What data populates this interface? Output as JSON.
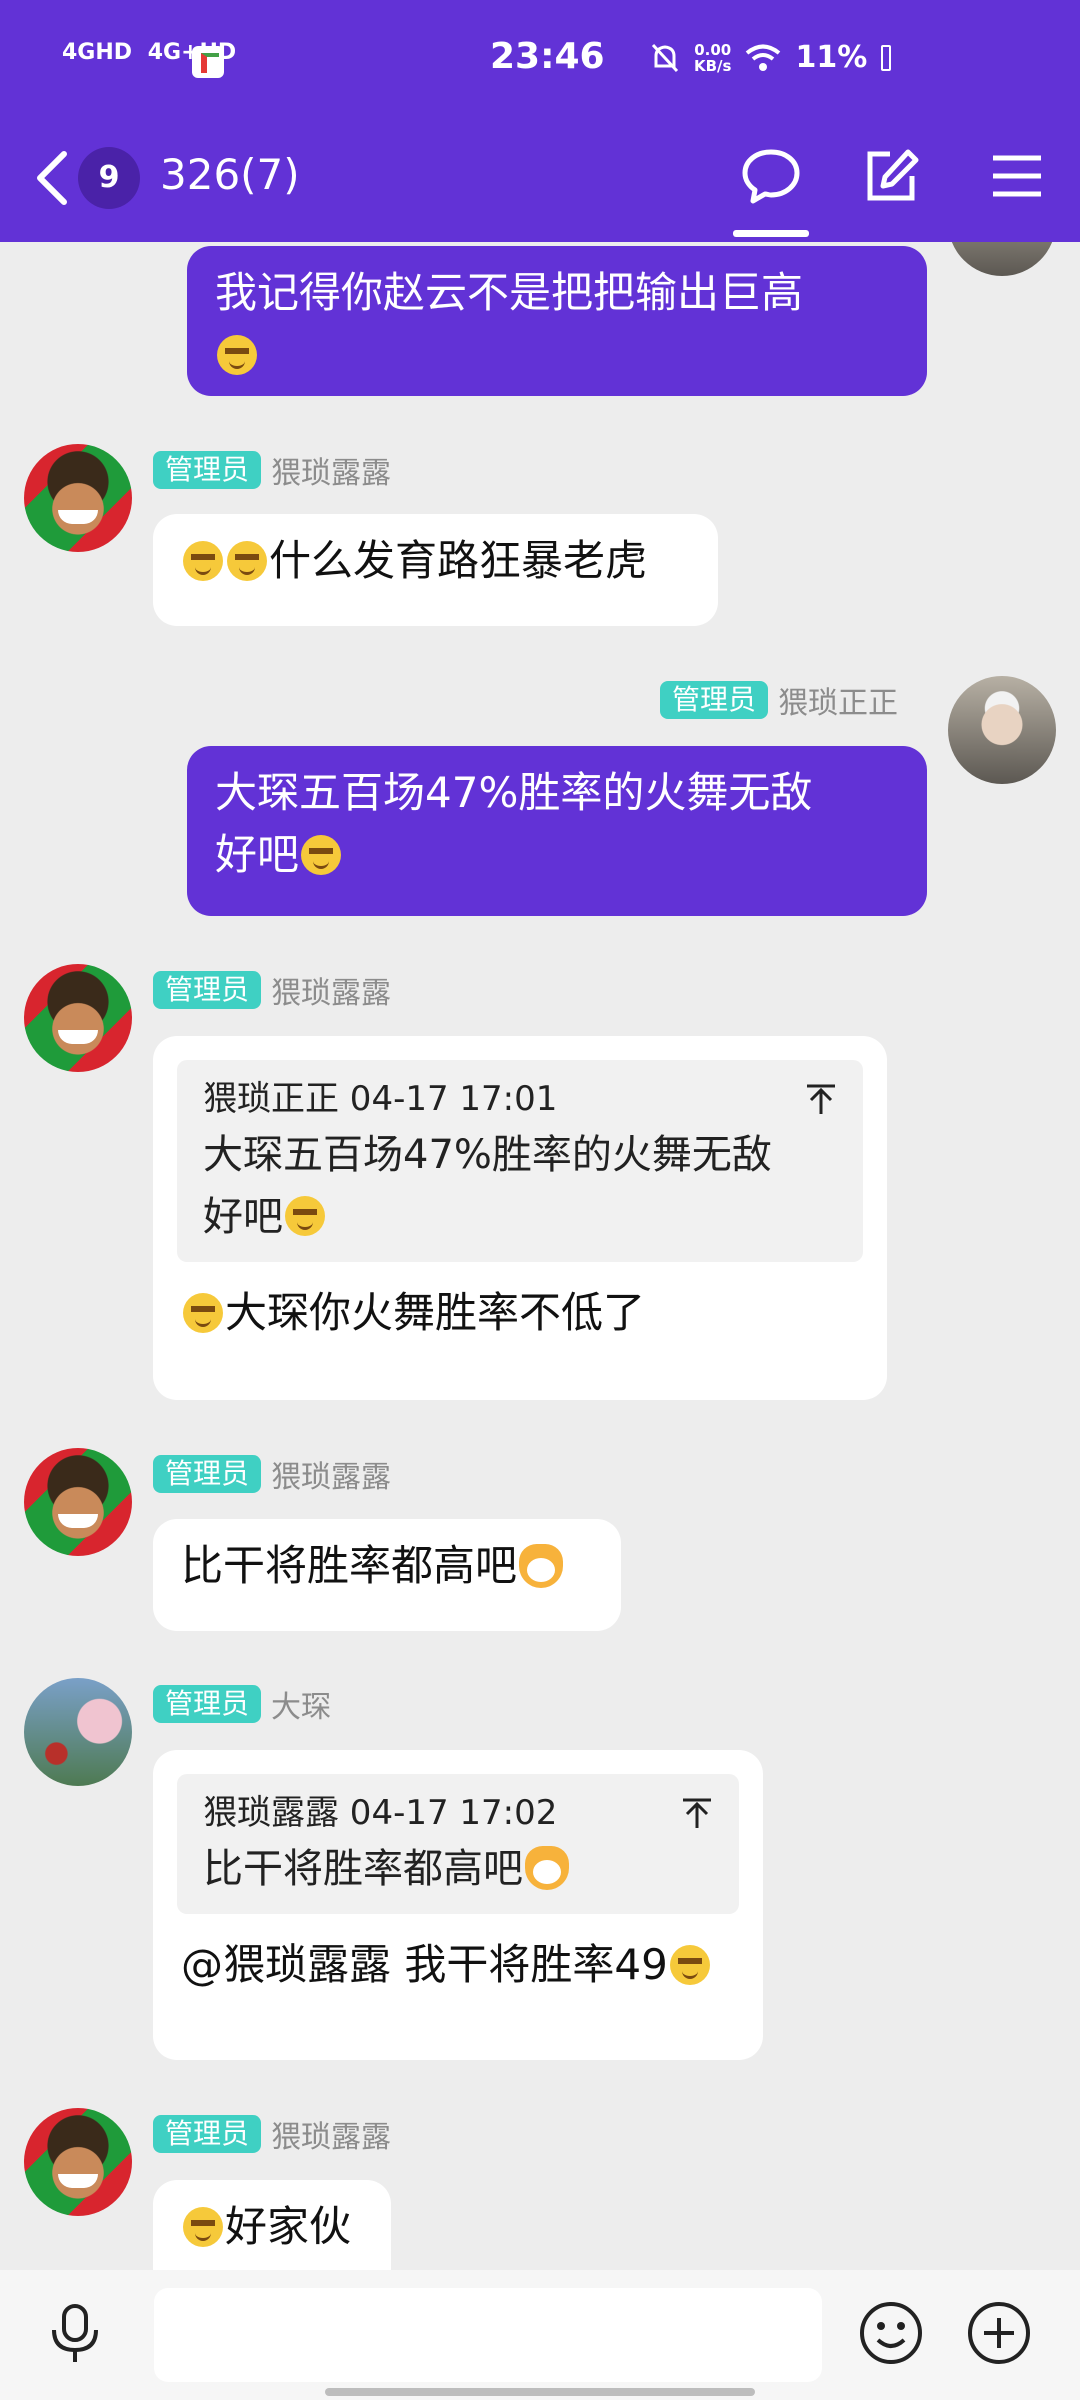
{
  "status_bar": {
    "net1": "4GHD",
    "net2": "4G+HD",
    "time": "23:46",
    "speed_value": "0.00",
    "speed_unit": "KB/s",
    "battery": "11%"
  },
  "header": {
    "unread_count": "9",
    "title": "326(7)",
    "icons": [
      "back-icon",
      "chat-bubble-icon",
      "edit-icon",
      "menu-icon"
    ]
  },
  "messages": [
    {
      "from": "me",
      "text": "我记得你赵云不是把把输出巨高"
    },
    {
      "sender_badge": "管理员",
      "sender": "猥琐露露",
      "text": "什么发育路狂暴老虎"
    },
    {
      "sender_badge": "管理员",
      "sender": "猥琐正正",
      "from": "me",
      "line1": "大琛五百场47%胜率的火舞无敌",
      "line2": "好吧"
    },
    {
      "sender_badge": "管理员",
      "sender": "猥琐露露",
      "quote_head": "猥琐正正 04-17 17:01",
      "quote_line1": "大琛五百场47%胜率的火舞无敌",
      "quote_line2": "好吧",
      "text": "大琛你火舞胜率不低了"
    },
    {
      "sender_badge": "管理员",
      "sender": "猥琐露露",
      "text": "比干将胜率都高吧"
    },
    {
      "sender_badge": "管理员",
      "sender": "大琛",
      "quote_head": "猥琐露露 04-17 17:02",
      "quote_text": "比干将胜率都高吧",
      "text": "@猥琐露露 我干将胜率49"
    },
    {
      "sender_badge": "管理员",
      "sender": "猥琐露露",
      "text": "好家伙"
    }
  ],
  "input_bar": {
    "placeholder": "",
    "icons": [
      "microphone-icon",
      "emoji-icon",
      "add-icon"
    ]
  },
  "colors": {
    "accent": "#6232d6",
    "admin_badge": "#3fd0c3",
    "background": "#ededed"
  }
}
